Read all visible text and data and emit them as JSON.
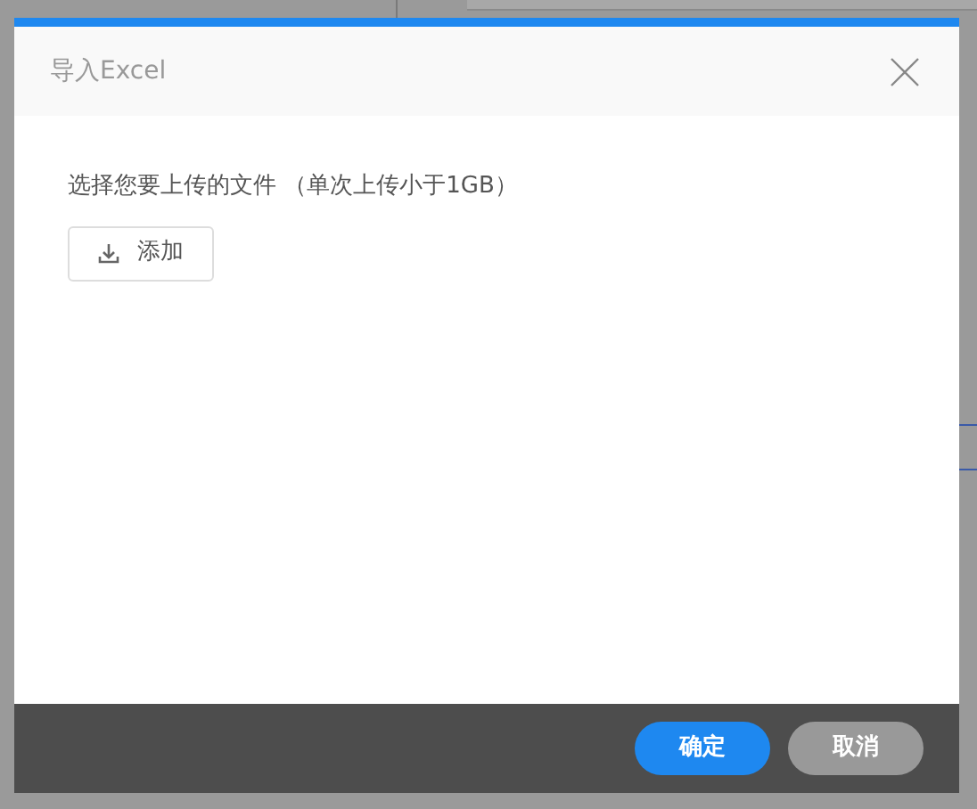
{
  "dialog": {
    "title": "导入Excel",
    "instruction": "选择您要上传的文件 （单次上传小于1GB）",
    "add_button": "添加"
  },
  "buttons": [
    {
      "label": "确定",
      "kind": "primary"
    },
    {
      "label": "取消",
      "kind": "secondary"
    }
  ]
}
